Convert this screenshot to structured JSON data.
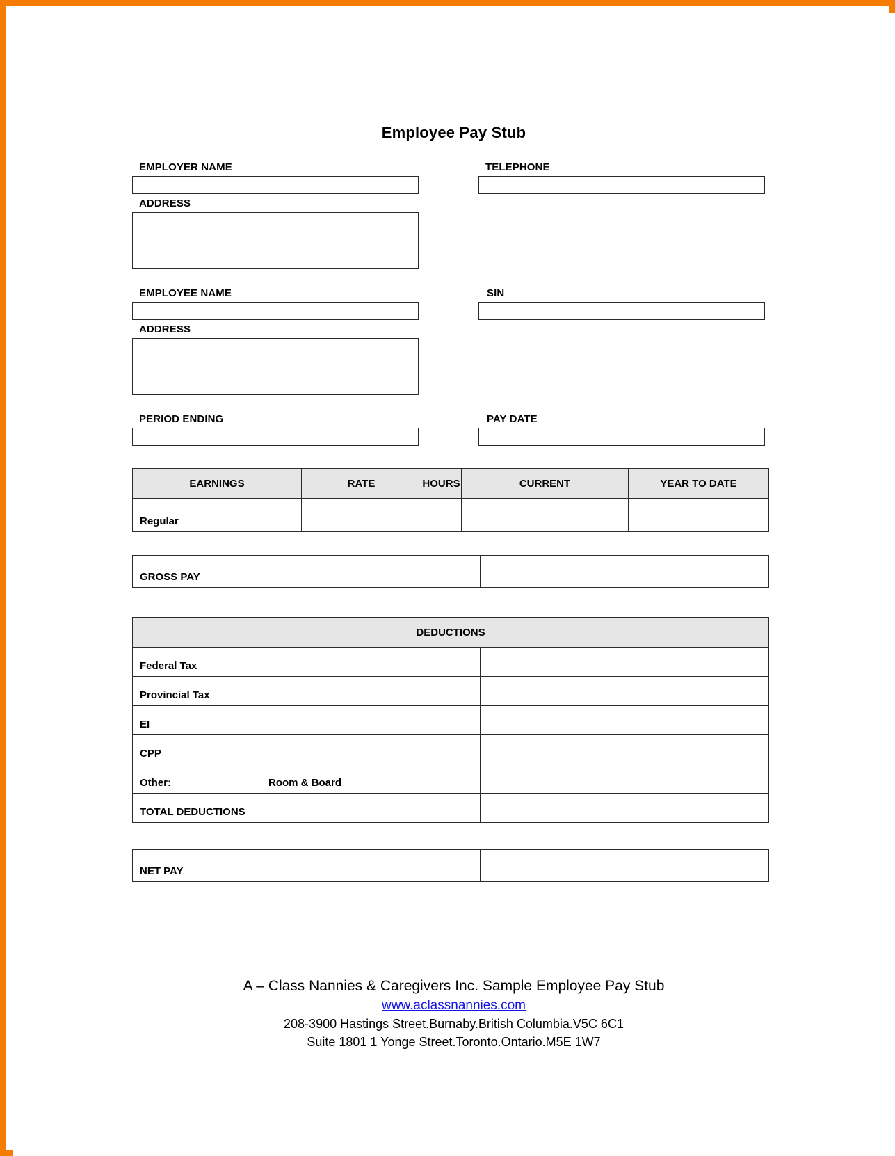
{
  "document": {
    "title": "Employee Pay Stub",
    "border_color": "#F57C00",
    "header_fill": "#e6e6e6"
  },
  "employer_section": {
    "name_label": "EMPLOYER NAME",
    "name_value": "",
    "telephone_label": "TELEPHONE",
    "telephone_value": "",
    "address_label": "ADDRESS",
    "address_value": ""
  },
  "employee_section": {
    "name_label": "EMPLOYEE NAME",
    "name_value": "",
    "sin_label": "SIN",
    "sin_value": "",
    "address_label": "ADDRESS",
    "address_value": ""
  },
  "period_section": {
    "period_ending_label": "PERIOD ENDING",
    "period_ending_value": "",
    "pay_date_label": "PAY DATE",
    "pay_date_value": ""
  },
  "earnings_table": {
    "columns": [
      "EARNINGS",
      "RATE",
      "HOURS",
      "CURRENT",
      "YEAR TO DATE"
    ],
    "rows": [
      {
        "label": "Regular",
        "rate": "",
        "hours": "",
        "current": "",
        "ytd": ""
      }
    ]
  },
  "gross_pay_row": {
    "label": "GROSS PAY",
    "current": "",
    "ytd": ""
  },
  "deductions_table": {
    "header": "DEDUCTIONS",
    "rows": [
      {
        "label": "Federal Tax",
        "current": "",
        "ytd": ""
      },
      {
        "label": "Provincial Tax",
        "current": "",
        "ytd": ""
      },
      {
        "label": "EI",
        "current": "",
        "ytd": ""
      },
      {
        "label": "CPP",
        "current": "",
        "ytd": ""
      }
    ],
    "other_row": {
      "key_label": "Other:",
      "value_label": "Room & Board",
      "current": "",
      "ytd": ""
    },
    "total_row": {
      "label": "TOTAL DEDUCTIONS",
      "current": "",
      "ytd": ""
    }
  },
  "net_pay_row": {
    "label": "NET PAY",
    "current": "",
    "ytd": ""
  },
  "footer": {
    "company_line": "A – Class Nannies & Caregivers Inc. Sample Employee Pay Stub",
    "website": "www.aclassnannies.com",
    "address_line_1": "208-3900 Hastings Street.Burnaby.British Columbia.V5C 6C1",
    "address_line_2": "Suite 1801 1 Yonge Street.Toronto.Ontario.M5E 1W7"
  }
}
